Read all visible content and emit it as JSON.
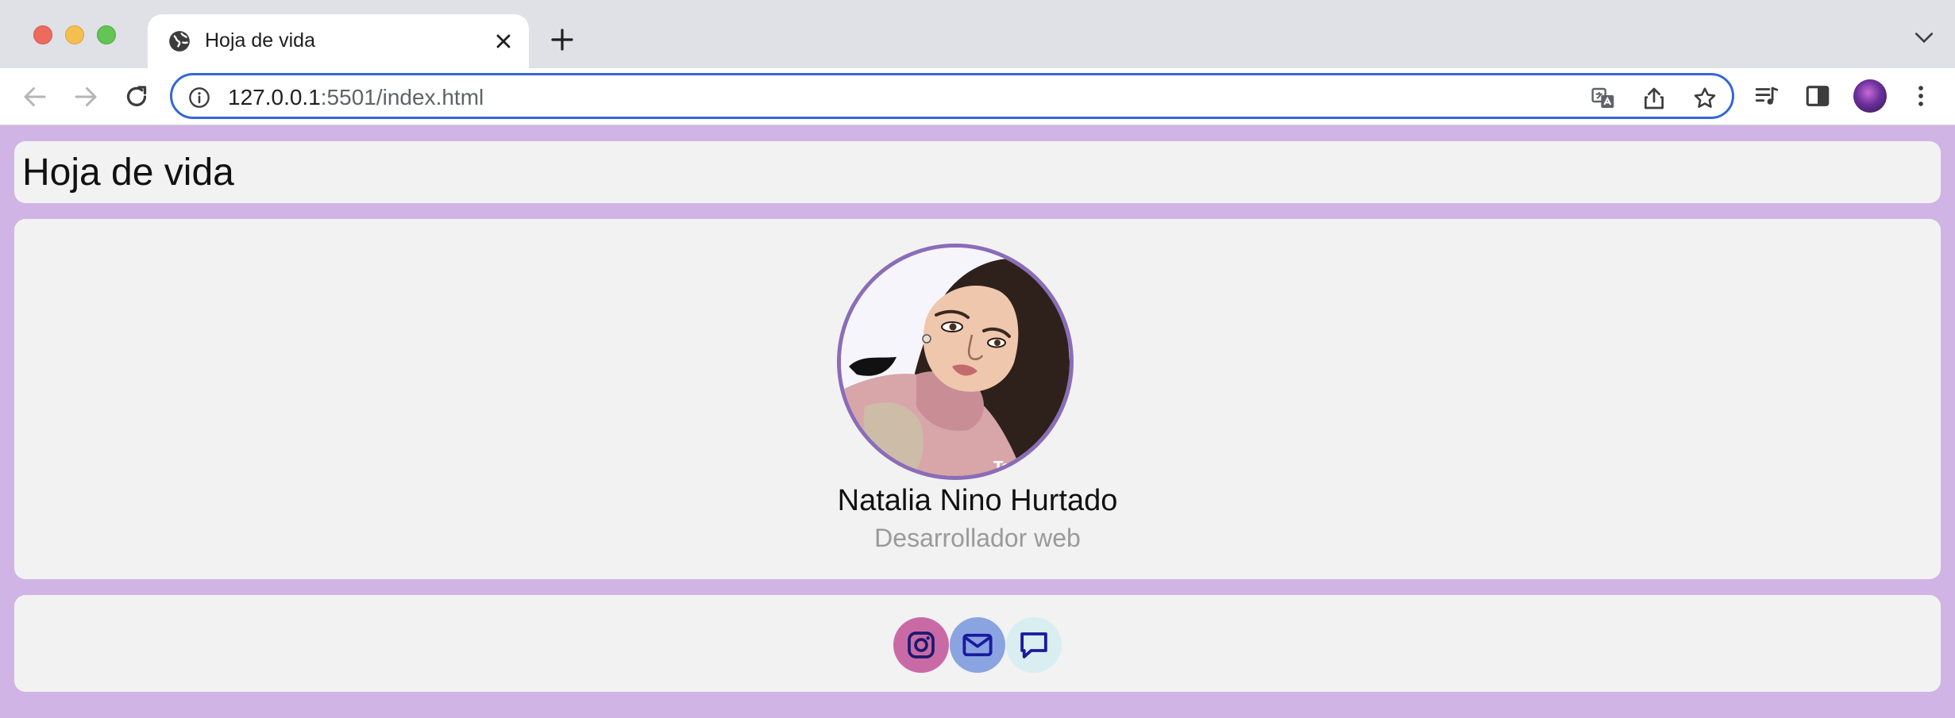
{
  "browser": {
    "tab_title": "Hoja de vida",
    "url_host": "127.0.0.1",
    "url_rest": ":5501/index.html"
  },
  "page": {
    "title": "Hoja de vida",
    "profile": {
      "name": "Natalia Nino Hurtado",
      "role": "Desarrollador web"
    },
    "social": [
      {
        "icon": "instagram-icon",
        "color": "#c96aa6"
      },
      {
        "icon": "mail-icon",
        "color": "#8aa4e2"
      },
      {
        "icon": "chat-icon",
        "color": "#d8eef0"
      }
    ]
  },
  "colors": {
    "page_background": "#d0b4e6",
    "card_background": "#f2f2f2",
    "photo_border": "#8a6db8",
    "icon_stroke": "#1a1a9e"
  }
}
